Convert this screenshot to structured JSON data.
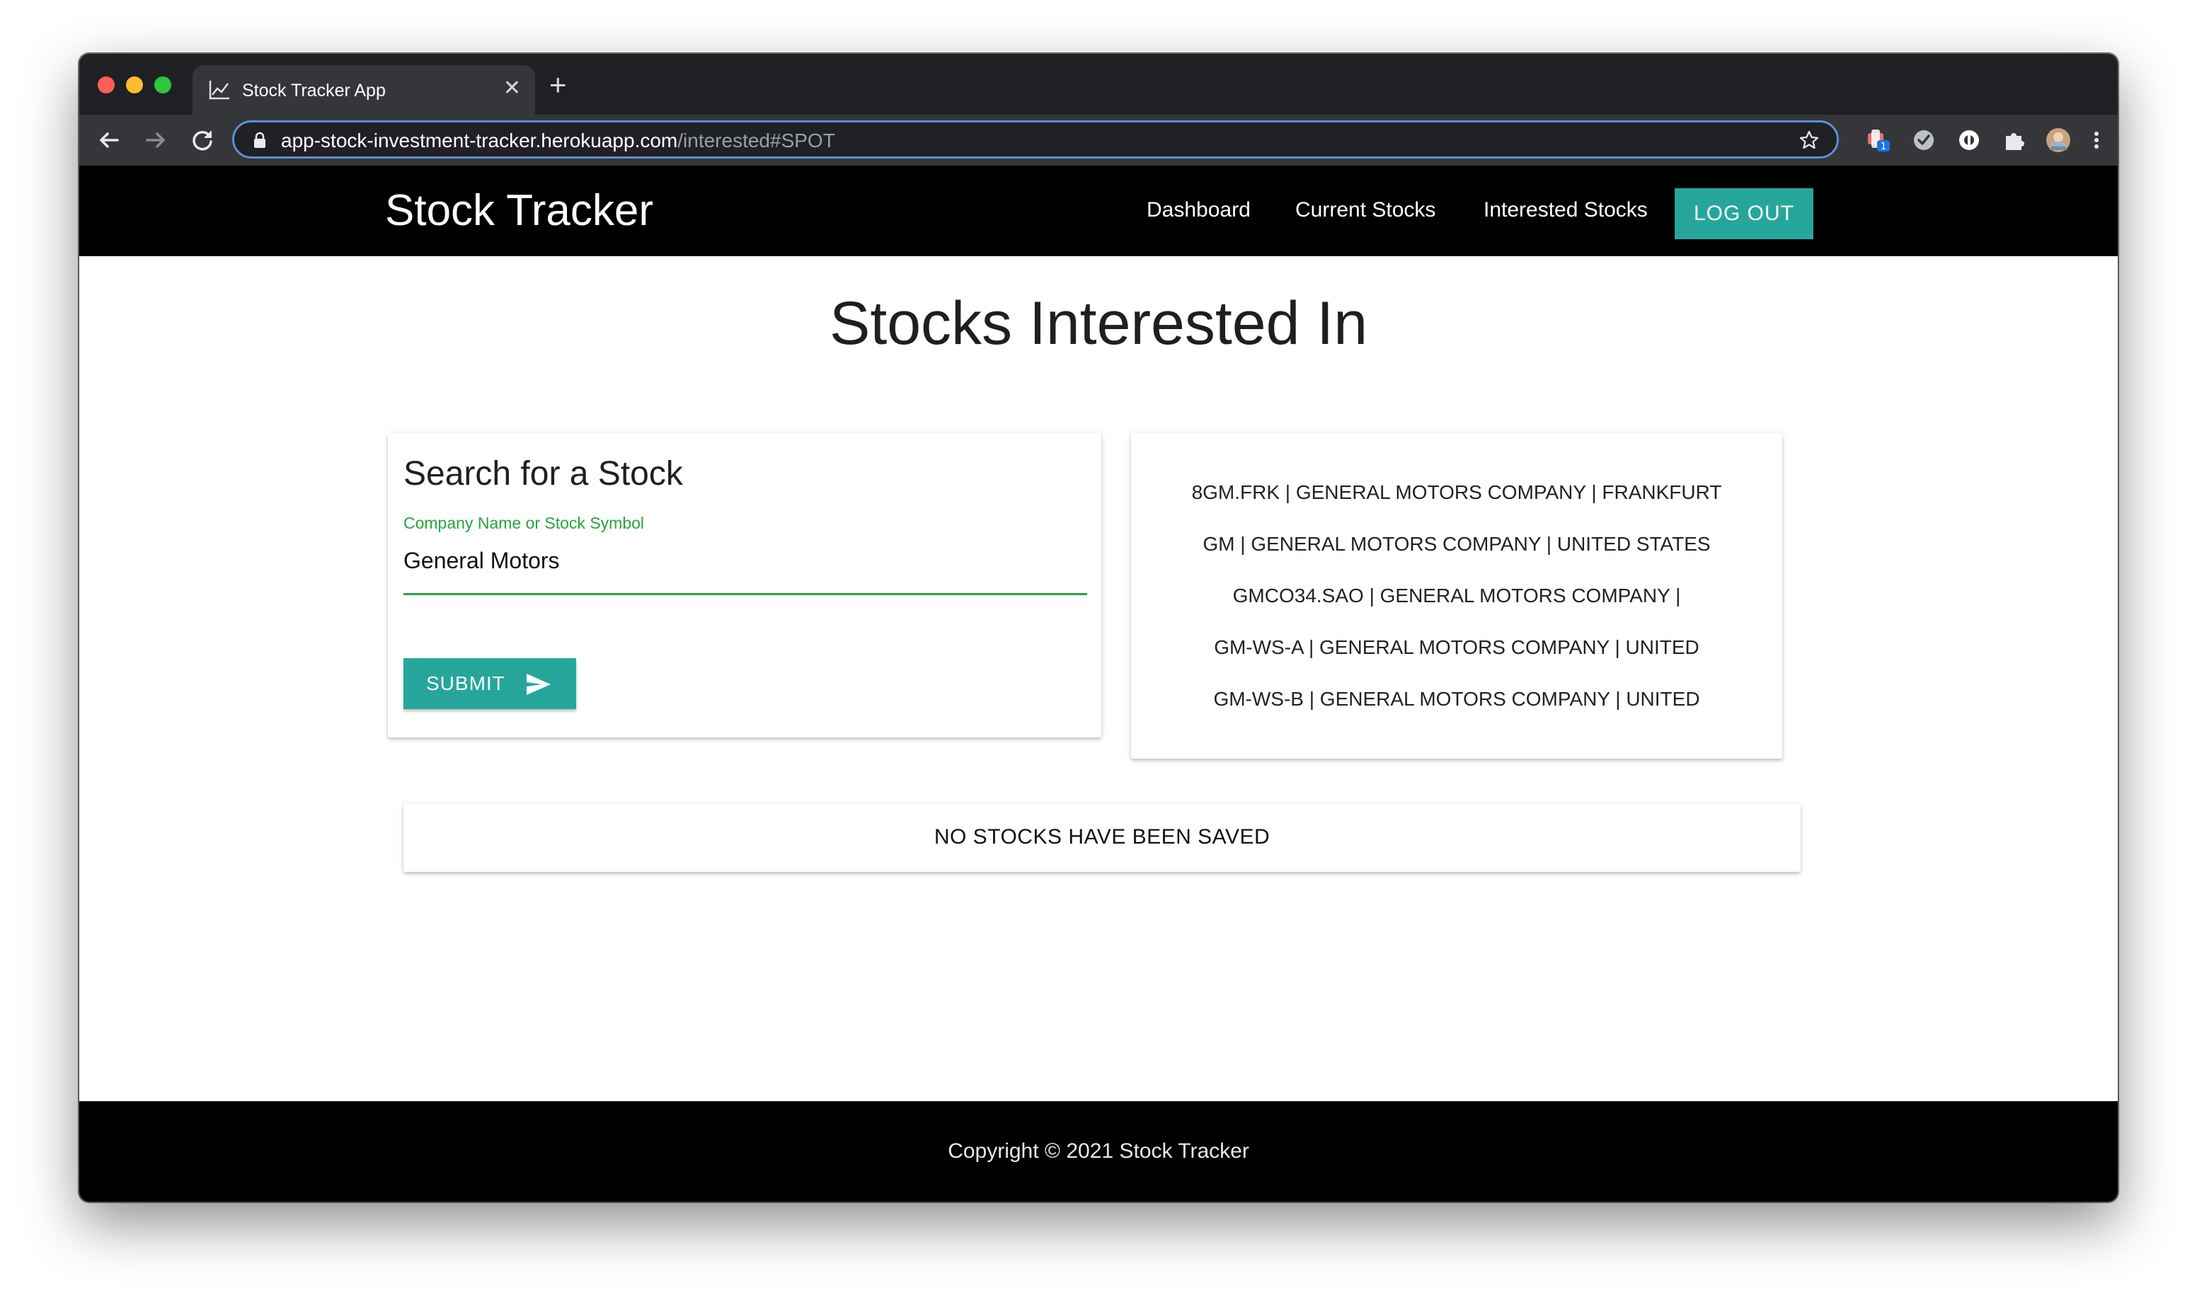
{
  "browser": {
    "tab_title": "Stock Tracker App",
    "tab_close": "✕",
    "new_tab": "+",
    "url_host": "app-stock-investment-tracker.herokuapp.com",
    "url_path": "/interested#SPOT",
    "extension_badge": "1"
  },
  "header": {
    "brand": "Stock Tracker",
    "nav": [
      "Dashboard",
      "Current Stocks",
      "Interested Stocks"
    ],
    "logout_label": "LOG OUT"
  },
  "page": {
    "title": "Stocks Interested In"
  },
  "search": {
    "title": "Search for a Stock",
    "field_label": "Company Name or Stock Symbol",
    "field_value": "General Motors",
    "submit_label": "SUBMIT"
  },
  "results": [
    "8GM.FRK | GENERAL MOTORS COMPANY | FRANKFURT",
    "GM | GENERAL MOTORS COMPANY | UNITED STATES",
    "GMCO34.SAO | GENERAL MOTORS COMPANY |",
    "GM-WS-A | GENERAL MOTORS COMPANY | UNITED",
    "GM-WS-B | GENERAL MOTORS COMPANY | UNITED"
  ],
  "saved": {
    "empty_message": "NO STOCKS HAVE BEEN SAVED"
  },
  "footer": {
    "copyright": "Copyright © 2021 Stock Tracker"
  },
  "colors": {
    "accent": "#26a69a",
    "field_focus": "#26a639",
    "header_bg": "#000000"
  }
}
